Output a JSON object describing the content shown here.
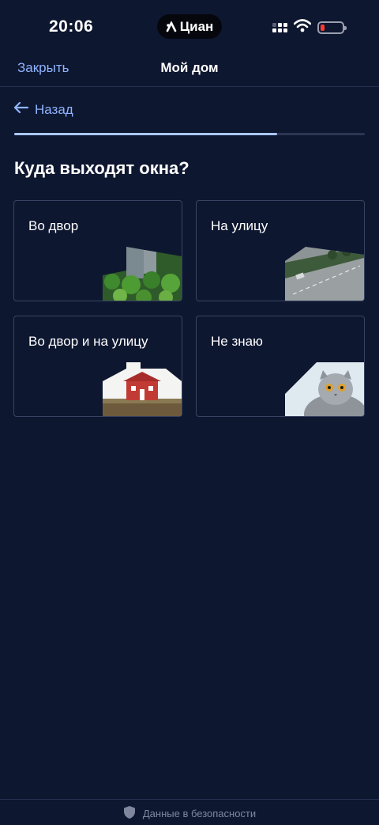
{
  "status_bar": {
    "time": "20:06",
    "carrier_app": "Циан",
    "icons": [
      "cian-logo-icon",
      "signal-icon",
      "wifi-icon",
      "battery-icon"
    ],
    "battery_color": "#ff3b30"
  },
  "header": {
    "close_label": "Закрыть",
    "title": "Мой дом"
  },
  "back": {
    "label": "Назад",
    "icon": "arrow-left-icon"
  },
  "progress": {
    "fraction": 0.75,
    "fill_color": "#a9c6ff"
  },
  "question": "Куда выходят окна?",
  "options": [
    {
      "label": "Во двор",
      "image": "courtyard-image"
    },
    {
      "label": "На улицу",
      "image": "street-image"
    },
    {
      "label": "Во двор и на улицу",
      "image": "house-image"
    },
    {
      "label": "Не знаю",
      "image": "cat-image"
    }
  ],
  "footer": {
    "label": "Данные в безопасности",
    "icon": "shield-icon"
  },
  "colors": {
    "background": "#0e1730",
    "accent_link": "#8fb4ff"
  }
}
